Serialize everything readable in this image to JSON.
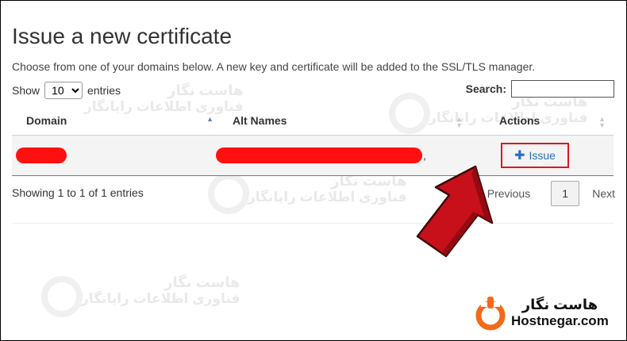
{
  "page": {
    "title": "Issue a new certificate",
    "subtitle": "Choose from one of your domains below. A new key and certificate will be added to the SSL/TLS manager."
  },
  "length_control": {
    "prefix": "Show",
    "value": "10",
    "suffix": "entries"
  },
  "search": {
    "label": "Search:",
    "value": ""
  },
  "table": {
    "columns": [
      "Domain",
      "Alt Names",
      "Actions"
    ],
    "rows": [
      {
        "domain": "[redacted]",
        "alt_names": ",",
        "action_label": "Issue"
      }
    ]
  },
  "footer": {
    "info": "Showing 1 to 1 of 1 entries",
    "previous": "Previous",
    "current_page": "1",
    "next": "Next"
  },
  "watermark": {
    "line1": "هاست نگار",
    "line2": "فناوری اطلاعات رایانگار"
  },
  "brand": {
    "name_fa": "هاست نگار",
    "name_en": "Hostnegar.com"
  },
  "colors": {
    "highlight_red": "#e0141e",
    "link_blue": "#2a6ebd",
    "brand_orange": "#f26a1b"
  }
}
